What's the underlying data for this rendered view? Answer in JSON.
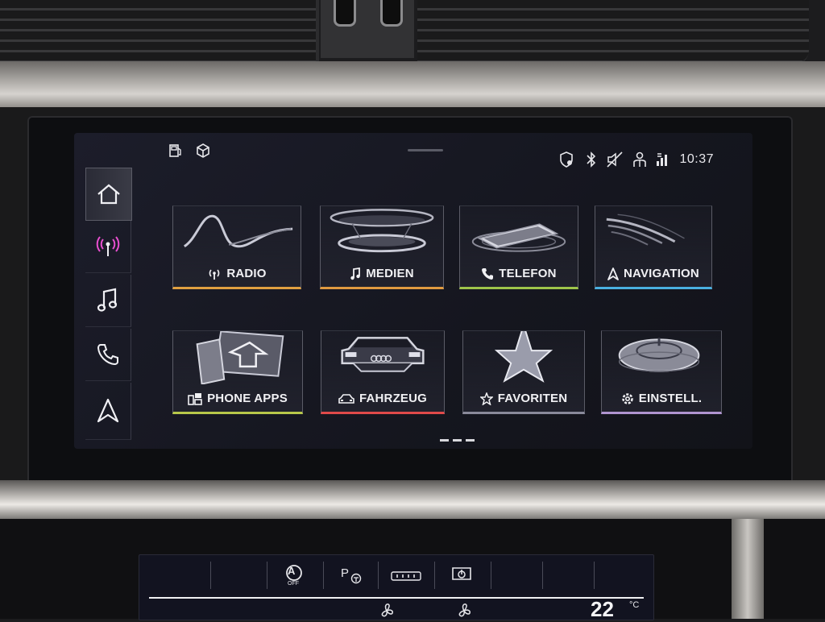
{
  "status_bar": {
    "clock": "10:37",
    "left_icons": [
      "fuel-icon",
      "cube-icon"
    ],
    "right_icons": [
      "location-shield-icon",
      "bluetooth-icon",
      "mute-icon",
      "user-icon",
      "data-icon"
    ]
  },
  "sidebar": {
    "items": [
      {
        "icon": "home-icon",
        "active": true
      },
      {
        "icon": "radio-antenna-icon",
        "active": false
      },
      {
        "icon": "music-note-icon",
        "active": false
      },
      {
        "icon": "phone-icon",
        "active": false
      },
      {
        "icon": "navigation-arrow-icon",
        "active": false
      }
    ]
  },
  "tiles": [
    {
      "label": "RADIO",
      "icon": "radio-antenna-icon",
      "accent": "#e0a040"
    },
    {
      "label": "MEDIEN",
      "icon": "music-note-icon",
      "accent": "#e09a40"
    },
    {
      "label": "TELEFON",
      "icon": "phone-icon",
      "accent": "#9ec44a"
    },
    {
      "label": "NAVIGATION",
      "icon": "navigation-arrow-icon",
      "accent": "#4ab0e0"
    },
    {
      "label": "PHONE APPS",
      "icon": "phone-apps-icon",
      "accent": "#b8c84a"
    },
    {
      "label": "FAHRZEUG",
      "icon": "car-icon",
      "accent": "#e04a4a"
    },
    {
      "label": "FAVORITEN",
      "icon": "star-icon",
      "accent": "#8a8a9a"
    },
    {
      "label": "EINSTELL.",
      "icon": "gear-icon",
      "accent": "#b094d0"
    }
  ],
  "pager": {
    "pages": 3
  },
  "climate": {
    "labels": [
      "A",
      "OFF",
      "P",
      "22"
    ],
    "unit": "°C"
  }
}
